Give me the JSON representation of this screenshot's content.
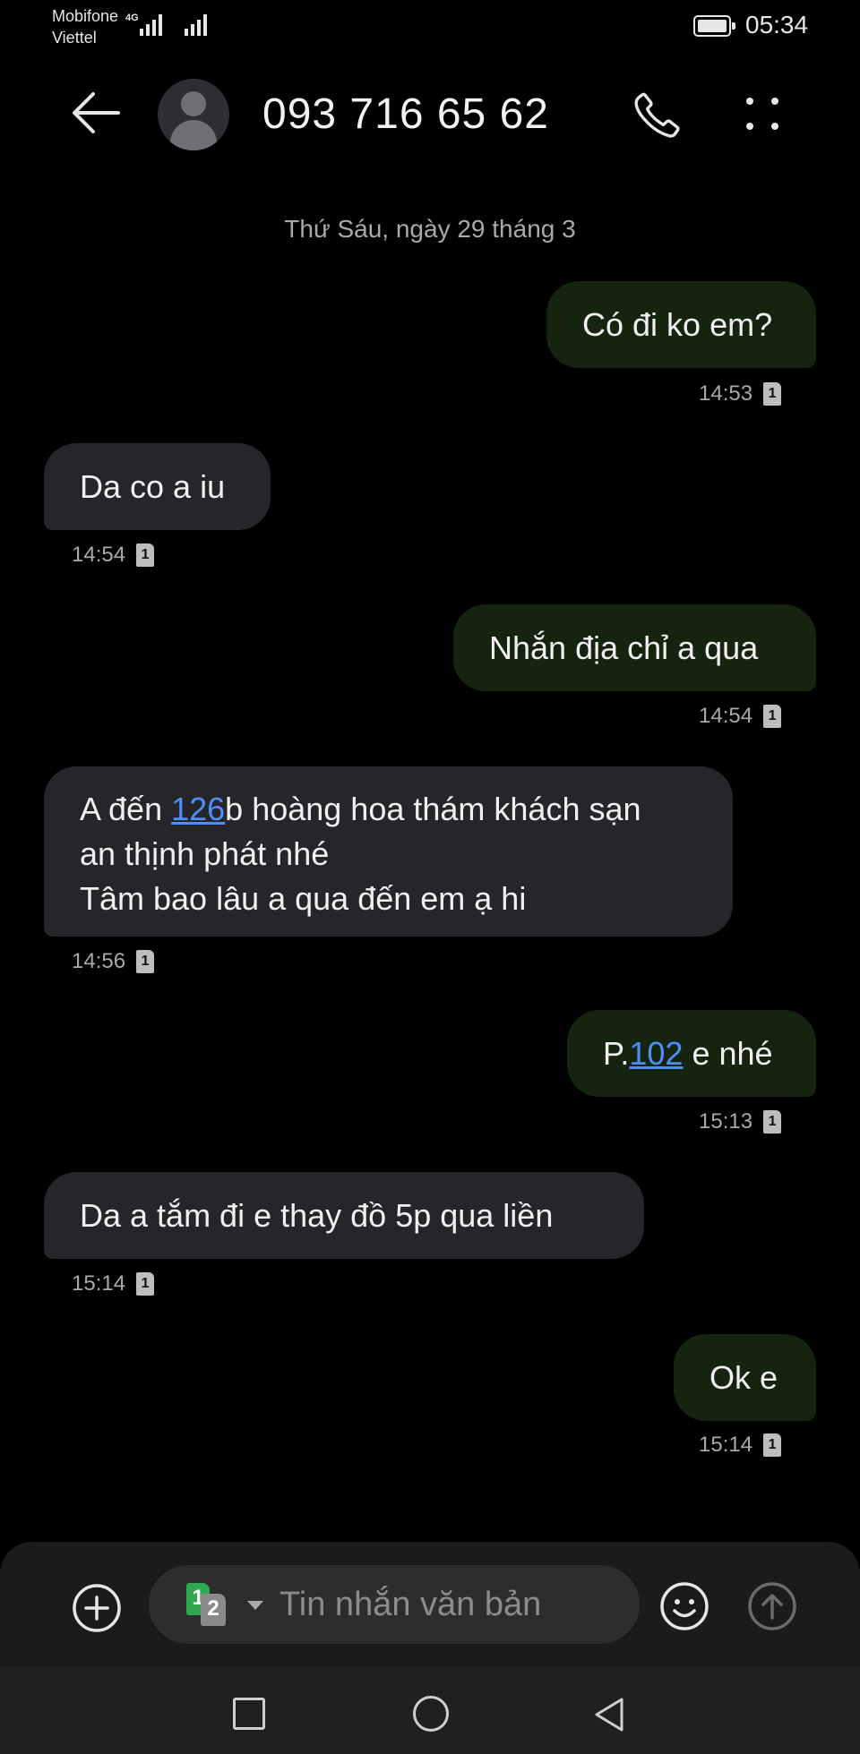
{
  "status_bar": {
    "carrier_1": "Mobifone",
    "carrier_2": "Viettel",
    "network": "4G",
    "time": "05:34"
  },
  "header": {
    "contact": "093 716 65 62",
    "icons": [
      "back-arrow-icon",
      "contact-avatar",
      "phone-icon",
      "more-dots-icon"
    ]
  },
  "conversation": {
    "date_separator": "Thứ Sáu, ngày 29 tháng 3",
    "messages": [
      {
        "direction": "outgoing",
        "text": "Có đi ko em?",
        "time": "14:53",
        "sim": "1"
      },
      {
        "direction": "incoming",
        "text": "Da co a iu",
        "time": "14:54",
        "sim": "1"
      },
      {
        "direction": "outgoing",
        "text": "Nhắn địa chỉ a qua",
        "time": "14:54",
        "sim": "1"
      },
      {
        "direction": "incoming",
        "line1_before": "A đến ",
        "line1_link": "126",
        "line1_after": "b hoàng hoa thám khách sạn",
        "line2": "an thịnh phát nhé",
        "line3": "Tâm bao lâu a qua đến em ạ hi",
        "time": "14:56",
        "sim": "1"
      },
      {
        "direction": "outgoing",
        "text_before": "P.",
        "text_link": "102",
        "text_after": " e nhé",
        "time": "15:13",
        "sim": "1"
      },
      {
        "direction": "incoming",
        "text": "Da a tắm đi e thay đồ 5p qua liền",
        "time": "15:14",
        "sim": "1"
      },
      {
        "direction": "outgoing",
        "text": "Ok e",
        "time": "15:14",
        "sim": "1"
      }
    ]
  },
  "composer": {
    "placeholder": "Tin nhắn văn bản",
    "sim_primary": "1",
    "sim_secondary": "2"
  },
  "colors": {
    "background": "#000000",
    "outgoing_bubble": "#15240f",
    "incoming_bubble": "#26262a",
    "link": "#4d8ff5",
    "sim1": "#2fa84f"
  }
}
